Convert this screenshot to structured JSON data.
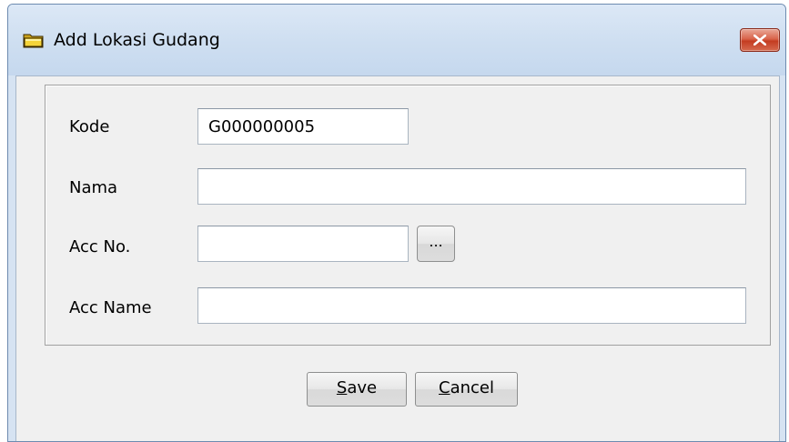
{
  "window": {
    "title": "Add Lokasi Gudang",
    "icon": "folder-icon",
    "close_icon": "close-icon",
    "close_color": "#c8432a"
  },
  "form": {
    "kode_label": "Kode",
    "kode_value": "G000000005",
    "nama_label": "Nama",
    "nama_value": "",
    "acc_no_label": "Acc No.",
    "acc_no_value": "",
    "browse_label": "...",
    "acc_name_label": "Acc Name",
    "acc_name_value": ""
  },
  "buttons": {
    "save_mnemonic": "S",
    "save_rest": "ave",
    "cancel_mnemonic": "C",
    "cancel_rest": "ancel"
  }
}
